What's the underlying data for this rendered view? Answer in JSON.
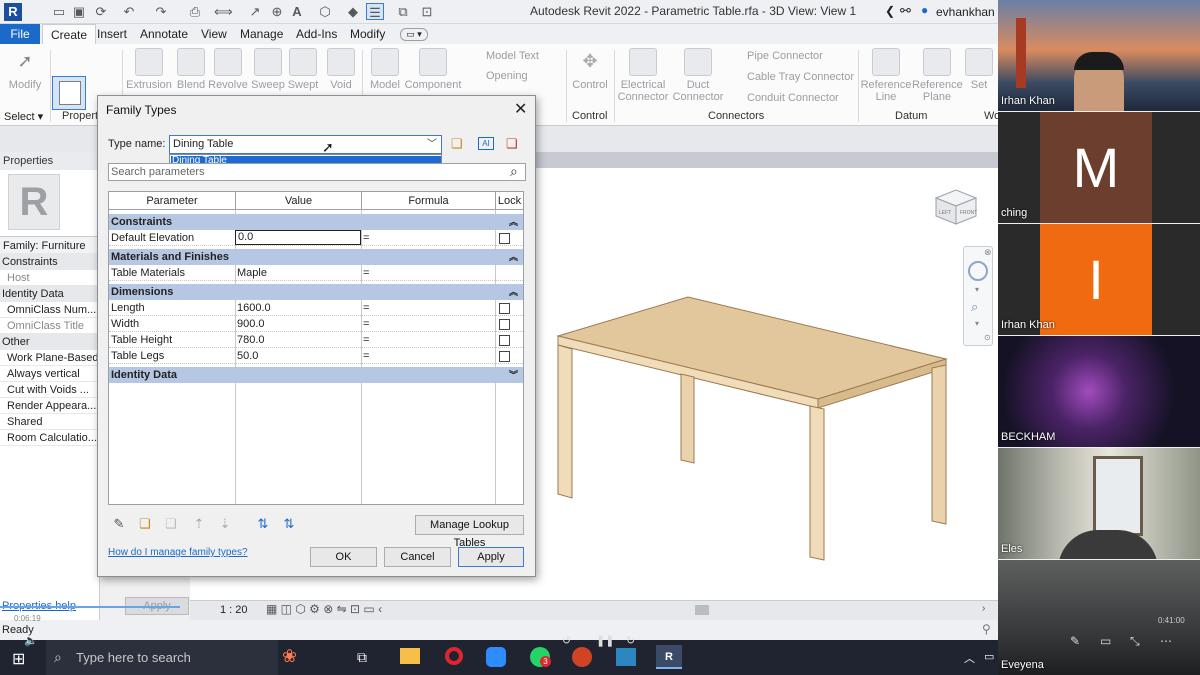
{
  "window": {
    "title": "Autodesk Revit 2022 - Parametric Table.rfa - 3D View: View 1",
    "user": "evhankhan"
  },
  "ribbon": {
    "tabs": [
      "File",
      "Create",
      "Insert",
      "Annotate",
      "View",
      "Manage",
      "Add-Ins",
      "Modify"
    ],
    "active_tab": "Create",
    "tools": {
      "modify": "Modify",
      "select": "Select",
      "properties": "Propert",
      "extrusion": "Extrusion",
      "blend": "Blend",
      "revolve": "Revolve",
      "sweep": "Sweep",
      "swept": "Swept",
      "void": "Void",
      "model": "Model",
      "component": "Component",
      "model_text": "Model Text",
      "opening": "Opening",
      "control": "Control",
      "control_panel": "Control",
      "electrical": "Electrical",
      "connector": "Connector",
      "duct": "Duct",
      "duct_connector": "Connector",
      "pipe_connector": "Pipe Connector",
      "cable_tray": "Cable Tray Connector",
      "conduit": "Conduit Connector",
      "connectors_panel": "Connectors",
      "ref_line": "Reference",
      "ref_line2": "Line",
      "ref_plane": "Reference",
      "ref_plane2": "Plane",
      "datum_panel": "Datum",
      "set": "Set",
      "wo": "Wo"
    }
  },
  "properties_palette": {
    "title": "Properties",
    "family": "Family: Furniture",
    "groups": [
      {
        "name": "Constraints",
        "rows": [
          "Host"
        ]
      },
      {
        "name": "Identity Data",
        "rows": [
          "OmniClass Num...",
          "OmniClass Title"
        ]
      },
      {
        "name": "Other",
        "rows": [
          "Work Plane-Based",
          "Always vertical",
          "Cut with Voids ...",
          "Render Appeara...",
          "Shared",
          "Room Calculatio..."
        ]
      }
    ],
    "help_link": "Properties help",
    "apply": "Apply"
  },
  "dialog": {
    "title": "Family Types",
    "type_name_label": "Type name:",
    "type_name_value": "Dining Table",
    "dropdown_option": "Dining Table",
    "search_placeholder": "Search parameters",
    "columns": [
      "Parameter",
      "Value",
      "Formula",
      "Lock"
    ],
    "sections": [
      {
        "name": "Constraints",
        "rows": [
          {
            "param": "Default Elevation",
            "value": "0.0",
            "formula": "=",
            "lock": true
          }
        ]
      },
      {
        "name": "Materials and Finishes",
        "rows": [
          {
            "param": "Table Materials",
            "value": "Maple",
            "formula": "=",
            "lock": false
          }
        ]
      },
      {
        "name": "Dimensions",
        "rows": [
          {
            "param": "Length",
            "value": "1600.0",
            "formula": "=",
            "lock": true
          },
          {
            "param": "Width",
            "value": "900.0",
            "formula": "=",
            "lock": true
          },
          {
            "param": "Table Height",
            "value": "780.0",
            "formula": "=",
            "lock": true
          },
          {
            "param": "Table Legs",
            "value": "50.0",
            "formula": "=",
            "lock": true
          }
        ]
      },
      {
        "name": "Identity Data",
        "rows": []
      }
    ],
    "manage_lookup": "Manage Lookup Tables",
    "help_link": "How do I manage family types?",
    "ok": "OK",
    "cancel": "Cancel",
    "apply": "Apply"
  },
  "viewport": {
    "scale": "1 : 20",
    "viewcube_left": "LEFT",
    "viewcube_front": "FRONT"
  },
  "status": {
    "ready": "Ready",
    "time_left": "0:06:19",
    "time_right": "0:41:00"
  },
  "taskbar": {
    "search_placeholder": "Type here to search",
    "zoom_badge": "3"
  },
  "participants": [
    {
      "name": "Irhan Khan",
      "kind": "photo"
    },
    {
      "name": "ching",
      "kind": "letter",
      "letter": "M",
      "color": "#6b3e2e"
    },
    {
      "name": "Irhan Khan",
      "kind": "letter",
      "letter": "I",
      "color": "#f06a0f"
    },
    {
      "name": "BECKHAM",
      "kind": "photo"
    },
    {
      "name": "Eles",
      "kind": "photo"
    },
    {
      "name": "Eveyena",
      "kind": "photo"
    }
  ],
  "colors": {
    "accent": "#1b6ac9",
    "section_header": "#b6c7e3",
    "table_wood": "#e7cfa8"
  }
}
